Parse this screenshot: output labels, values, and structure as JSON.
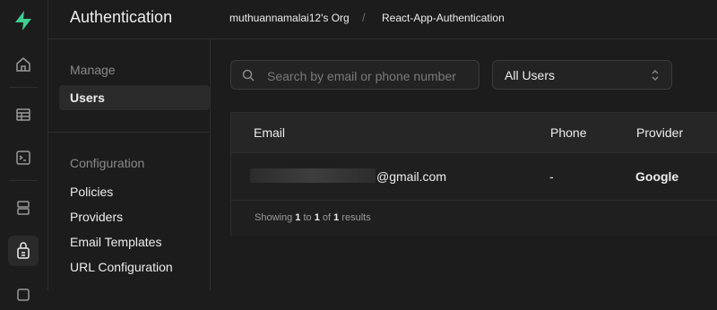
{
  "header": {
    "title": "Authentication",
    "org": "muthuannamalai12's Org",
    "separator": "/",
    "project": "React-App-Authentication"
  },
  "rail": {
    "icons": [
      "logo-icon",
      "home-icon",
      "table-editor-icon",
      "sql-editor-icon",
      "database-icon",
      "auth-icon",
      "storage-icon"
    ],
    "brand_color": "#3ecf8e"
  },
  "menu": {
    "manage_title": "Manage",
    "manage_items": [
      {
        "label": "Users",
        "active": true
      }
    ],
    "config_title": "Configuration",
    "config_items": [
      {
        "label": "Policies"
      },
      {
        "label": "Providers"
      },
      {
        "label": "Email Templates"
      },
      {
        "label": "URL Configuration"
      }
    ]
  },
  "toolbar": {
    "search_placeholder": "Search by email or phone number",
    "filter_value": "All Users"
  },
  "table": {
    "columns": [
      "Email",
      "Phone",
      "Provider"
    ],
    "rows": [
      {
        "email_suffix": "@gmail.com",
        "phone": "-",
        "provider": "Google"
      }
    ],
    "footer": {
      "prefix": "Showing ",
      "from": "1",
      "to_word": " to ",
      "to": "1",
      "of_word": " of ",
      "total": "1",
      "suffix": " results"
    }
  }
}
